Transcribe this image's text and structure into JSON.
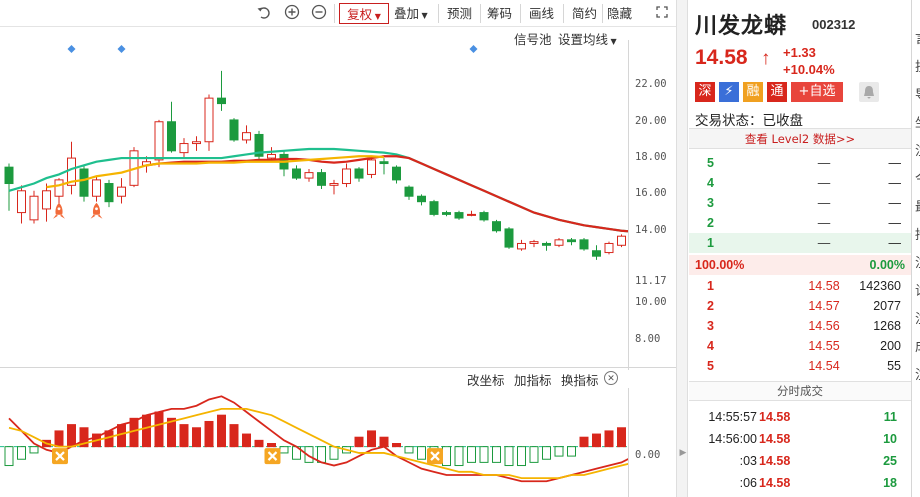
{
  "toolbar": {
    "undo_icon": "undo-icon",
    "zoom_in_icon": "zoom-in-icon",
    "zoom_out_icon": "zoom-out-icon",
    "fuquan_label": "复权",
    "diejia_label": "叠加",
    "yuce_label": "预测",
    "chouma_label": "筹码",
    "huaxian_label": "画线",
    "jianyue_label": "简约",
    "yincang_label": "隐藏",
    "expand_icon": "expand-icon"
  },
  "subtoolbar": {
    "signal_pool": "信号池",
    "set_ma": "设置均线"
  },
  "price_axis": {
    "ticks": [
      "22.00",
      "20.00",
      "18.00",
      "16.00",
      "14.00",
      "11.17",
      "10.00",
      "8.00"
    ]
  },
  "indicator": {
    "change_axis": "改坐标",
    "add_indicator": "加指标",
    "switch_indicator": "换指标",
    "close_icon": "close-icon",
    "zero_label": "0.00"
  },
  "panel": {
    "name": "川发龙蟒",
    "code": "002312",
    "price": "14.58",
    "up_arrow": "↑",
    "change_abs": "+1.33",
    "change_pct": "+10.04%",
    "tags": [
      "深",
      "⚡",
      "融",
      "通",
      "+自选"
    ],
    "bell_icon": "bell-icon",
    "trade_state": "交易状态：已收盘",
    "level2": "查看 Level2 数据>>",
    "sell_rows": [
      {
        "lvl": "5",
        "price": "—",
        "vol": "—"
      },
      {
        "lvl": "4",
        "price": "—",
        "vol": "—"
      },
      {
        "lvl": "3",
        "price": "—",
        "vol": "—"
      },
      {
        "lvl": "2",
        "price": "—",
        "vol": "—"
      },
      {
        "lvl": "1",
        "price": "—",
        "vol": "—"
      }
    ],
    "weibi_left": "100.00%",
    "weibi_right": "0.00%",
    "buy_rows": [
      {
        "lvl": "1",
        "price": "14.58",
        "vol": "142360"
      },
      {
        "lvl": "2",
        "price": "14.57",
        "vol": "2077"
      },
      {
        "lvl": "3",
        "price": "14.56",
        "vol": "1268"
      },
      {
        "lvl": "4",
        "price": "14.55",
        "vol": "200"
      },
      {
        "lvl": "5",
        "price": "14.54",
        "vol": "55"
      }
    ],
    "ticks_title": "分时成交",
    "ticks": [
      {
        "time": "14:55:57",
        "price": "14.58",
        "vol": "11",
        "color": "#1c9a3e"
      },
      {
        "time": "14:56:00",
        "price": "14.58",
        "vol": "10",
        "color": "#1c9a3e"
      },
      {
        "time": ":03",
        "price": "14.58",
        "vol": "25",
        "color": "#1c9a3e"
      },
      {
        "time": ":06",
        "price": "14.58",
        "vol": "18",
        "color": "#1c9a3e"
      }
    ]
  },
  "right_clip_chars": [
    "言",
    "挂",
    "导",
    "坐",
    "注",
    "今",
    "最",
    "持",
    "注",
    "试",
    "注",
    "成",
    "注"
  ],
  "colors": {
    "up": "#d8271c",
    "down": "#1c9a3e",
    "ma_short": "#f5b400",
    "ma_long": "#1fbf8e",
    "ma_red": "#d8271c",
    "signal": "#4a90e2"
  },
  "chart_data": {
    "type": "candlestick",
    "y_range": [
      6.5,
      24.5
    ],
    "y_ticks": [
      22,
      20,
      18,
      16,
      14,
      10,
      8
    ],
    "current_marker": 11.17,
    "candles": [
      [
        17.5,
        16.6,
        15.1,
        17.7
      ],
      [
        15.0,
        16.2,
        14.4,
        16.5
      ],
      [
        14.6,
        15.9,
        14.4,
        16.2
      ],
      [
        15.2,
        16.2,
        14.5,
        16.6
      ],
      [
        15.9,
        16.8,
        15.4,
        16.9
      ],
      [
        16.5,
        18.0,
        16.0,
        18.9
      ],
      [
        17.4,
        15.9,
        15.6,
        17.6
      ],
      [
        15.9,
        16.8,
        15.6,
        17.0
      ],
      [
        16.6,
        15.6,
        15.3,
        16.8
      ],
      [
        15.9,
        16.4,
        15.5,
        16.9
      ],
      [
        16.5,
        18.4,
        16.4,
        18.6
      ],
      [
        17.6,
        17.8,
        17.2,
        18.1
      ],
      [
        17.9,
        20.0,
        17.5,
        20.1
      ],
      [
        20.0,
        18.4,
        18.3,
        21.1
      ],
      [
        18.3,
        18.8,
        18.0,
        19.1
      ],
      [
        18.8,
        18.9,
        18.4,
        19.2
      ],
      [
        18.9,
        21.3,
        18.4,
        21.5
      ],
      [
        21.3,
        21.0,
        20.6,
        22.8
      ],
      [
        20.1,
        19.0,
        18.9,
        20.2
      ],
      [
        19.0,
        19.4,
        18.8,
        19.8
      ],
      [
        19.3,
        18.1,
        17.9,
        19.5
      ],
      [
        18.0,
        18.2,
        17.8,
        18.6
      ],
      [
        18.2,
        17.4,
        17.0,
        18.4
      ],
      [
        17.4,
        16.9,
        16.8,
        17.6
      ],
      [
        16.9,
        17.2,
        16.7,
        17.4
      ],
      [
        17.2,
        16.5,
        16.3,
        17.4
      ],
      [
        16.5,
        16.6,
        16.0,
        16.8
      ],
      [
        16.6,
        17.4,
        16.4,
        17.7
      ],
      [
        17.4,
        16.9,
        16.7,
        17.5
      ],
      [
        17.1,
        17.9,
        16.9,
        18.0
      ],
      [
        17.8,
        17.7,
        17.1,
        18.0
      ],
      [
        17.5,
        16.8,
        16.6,
        17.6
      ],
      [
        16.4,
        15.9,
        15.7,
        16.5
      ],
      [
        15.9,
        15.6,
        15.4,
        16.0
      ],
      [
        15.6,
        14.9,
        14.8,
        15.7
      ],
      [
        15.0,
        14.9,
        14.8,
        15.1
      ],
      [
        15.0,
        14.7,
        14.6,
        15.1
      ],
      [
        14.9,
        14.9,
        14.8,
        15.1
      ],
      [
        15.0,
        14.6,
        14.5,
        15.1
      ],
      [
        14.5,
        14.0,
        13.9,
        14.6
      ],
      [
        14.1,
        13.1,
        13.0,
        14.2
      ],
      [
        13.0,
        13.3,
        12.9,
        13.5
      ],
      [
        13.3,
        13.4,
        13.1,
        13.5
      ],
      [
        13.3,
        13.2,
        12.9,
        13.4
      ],
      [
        13.2,
        13.5,
        13.1,
        13.6
      ],
      [
        13.5,
        13.4,
        13.2,
        13.6
      ],
      [
        13.5,
        13.0,
        12.9,
        13.6
      ],
      [
        12.9,
        12.6,
        12.4,
        13.2
      ],
      [
        12.8,
        13.3,
        12.7,
        13.4
      ],
      [
        13.2,
        13.7,
        13.1,
        13.8
      ],
      [
        13.6,
        13.7,
        13.3,
        13.8
      ],
      [
        13.7,
        13.5,
        13.3,
        13.8
      ],
      [
        13.3,
        14.6,
        13.2,
        14.7
      ]
    ],
    "ma_long": [
      16.2,
      16.4,
      16.6,
      16.9,
      17.1,
      17.4,
      17.6,
      17.8,
      17.9,
      18.0,
      18.0,
      18.0,
      18.0,
      18.0,
      18.0,
      18.0,
      18.0,
      18.0,
      18.1,
      18.2,
      18.3,
      18.35,
      18.4,
      18.45,
      18.5,
      18.5,
      18.5,
      18.45,
      18.4,
      18.35,
      18.3,
      18.2,
      18.0,
      17.7,
      17.4,
      17.1,
      16.8,
      16.5,
      16.2,
      15.9,
      15.6,
      15.3,
      15.0,
      14.8,
      14.6,
      14.45,
      14.3,
      14.2,
      14.1,
      14.0,
      13.95,
      13.9,
      13.9
    ],
    "ma_red": [
      null,
      null,
      null,
      null,
      null,
      null,
      null,
      null,
      null,
      null,
      null,
      17.6,
      17.7,
      17.75,
      17.8,
      17.8,
      17.8,
      17.8,
      17.85,
      17.85,
      17.9,
      17.9,
      17.95,
      17.95,
      17.9,
      17.8,
      17.75,
      17.8,
      17.9,
      18.0,
      18.1,
      18.1,
      18.0,
      17.7,
      17.4,
      17.1,
      16.8,
      16.5,
      16.2,
      15.9,
      15.6,
      15.3,
      15.0,
      14.8,
      14.6,
      14.45,
      14.3,
      14.2,
      14.1,
      14.0,
      13.95,
      13.9,
      13.9
    ],
    "ma_short": [
      null,
      null,
      null,
      16.4,
      16.5,
      16.7,
      16.8,
      17.0,
      17.1,
      17.2,
      17.4,
      17.6,
      17.7,
      17.7,
      17.7,
      17.7,
      17.75,
      17.75,
      17.75,
      17.8,
      17.8,
      17.8,
      17.8,
      17.85,
      17.9,
      17.95,
      18.0,
      18.05,
      18.1,
      18.1,
      18.05,
      null,
      null,
      null,
      null,
      null,
      null,
      null,
      null,
      null,
      null,
      null,
      null,
      null,
      null,
      null,
      null,
      null,
      null,
      null,
      null,
      null,
      null
    ],
    "signal_dots": [
      5,
      9,
      37
    ],
    "rocket_marks": [
      4,
      7
    ],
    "macd_bars": [
      -0.6,
      -0.4,
      -0.2,
      0.2,
      0.5,
      0.7,
      0.6,
      0.4,
      0.5,
      0.7,
      0.9,
      1.0,
      1.1,
      0.9,
      0.7,
      0.6,
      0.8,
      1.0,
      0.7,
      0.4,
      0.2,
      0.1,
      -0.2,
      -0.4,
      -0.5,
      -0.5,
      -0.4,
      -0.2,
      0.3,
      0.5,
      0.3,
      0.1,
      -0.2,
      -0.4,
      -0.5,
      -0.6,
      -0.6,
      -0.5,
      -0.5,
      -0.5,
      -0.6,
      -0.6,
      -0.5,
      -0.4,
      -0.3,
      -0.3,
      0.3,
      0.4,
      0.5,
      0.6,
      0.7,
      0.8,
      1.0
    ],
    "dif": [
      0.9,
      0.5,
      0.1,
      -0.1,
      -0.2,
      0.0,
      0.2,
      0.3,
      0.5,
      0.7,
      0.8,
      1.0,
      1.1,
      1.2,
      1.2,
      1.3,
      1.5,
      1.6,
      1.4,
      1.1,
      0.8,
      0.5,
      0.2,
      0.0,
      -0.3,
      -0.5,
      -0.6,
      -0.5,
      -0.3,
      -0.1,
      0.0,
      -0.3,
      -0.5,
      -0.7,
      -0.8,
      -0.9,
      -0.9,
      -0.9,
      -0.9,
      -0.9,
      -1.0,
      -1.1,
      -1.1,
      -1.1,
      -1.0,
      -0.9,
      -0.8,
      -0.7,
      -0.6,
      -0.5,
      -0.3,
      -0.1,
      0.1
    ],
    "dea": [
      0.6,
      0.5,
      0.3,
      0.1,
      0.0,
      0.0,
      0.1,
      0.2,
      0.3,
      0.4,
      0.5,
      0.6,
      0.7,
      0.8,
      0.9,
      1.0,
      1.1,
      1.2,
      1.2,
      1.2,
      1.1,
      1.0,
      0.8,
      0.6,
      0.4,
      0.2,
      0.0,
      -0.1,
      -0.2,
      -0.2,
      -0.2,
      -0.3,
      -0.4,
      -0.5,
      -0.6,
      -0.7,
      -0.8,
      -0.8,
      -0.9,
      -0.9,
      -0.9,
      -1.0,
      -1.0,
      -1.0,
      -1.0,
      -0.9,
      -0.9,
      -0.8,
      -0.7,
      -0.6,
      -0.5,
      -0.4,
      -0.3
    ],
    "x_marks": [
      4,
      21,
      34
    ],
    "macd_range": [
      -1.6,
      1.8
    ]
  }
}
